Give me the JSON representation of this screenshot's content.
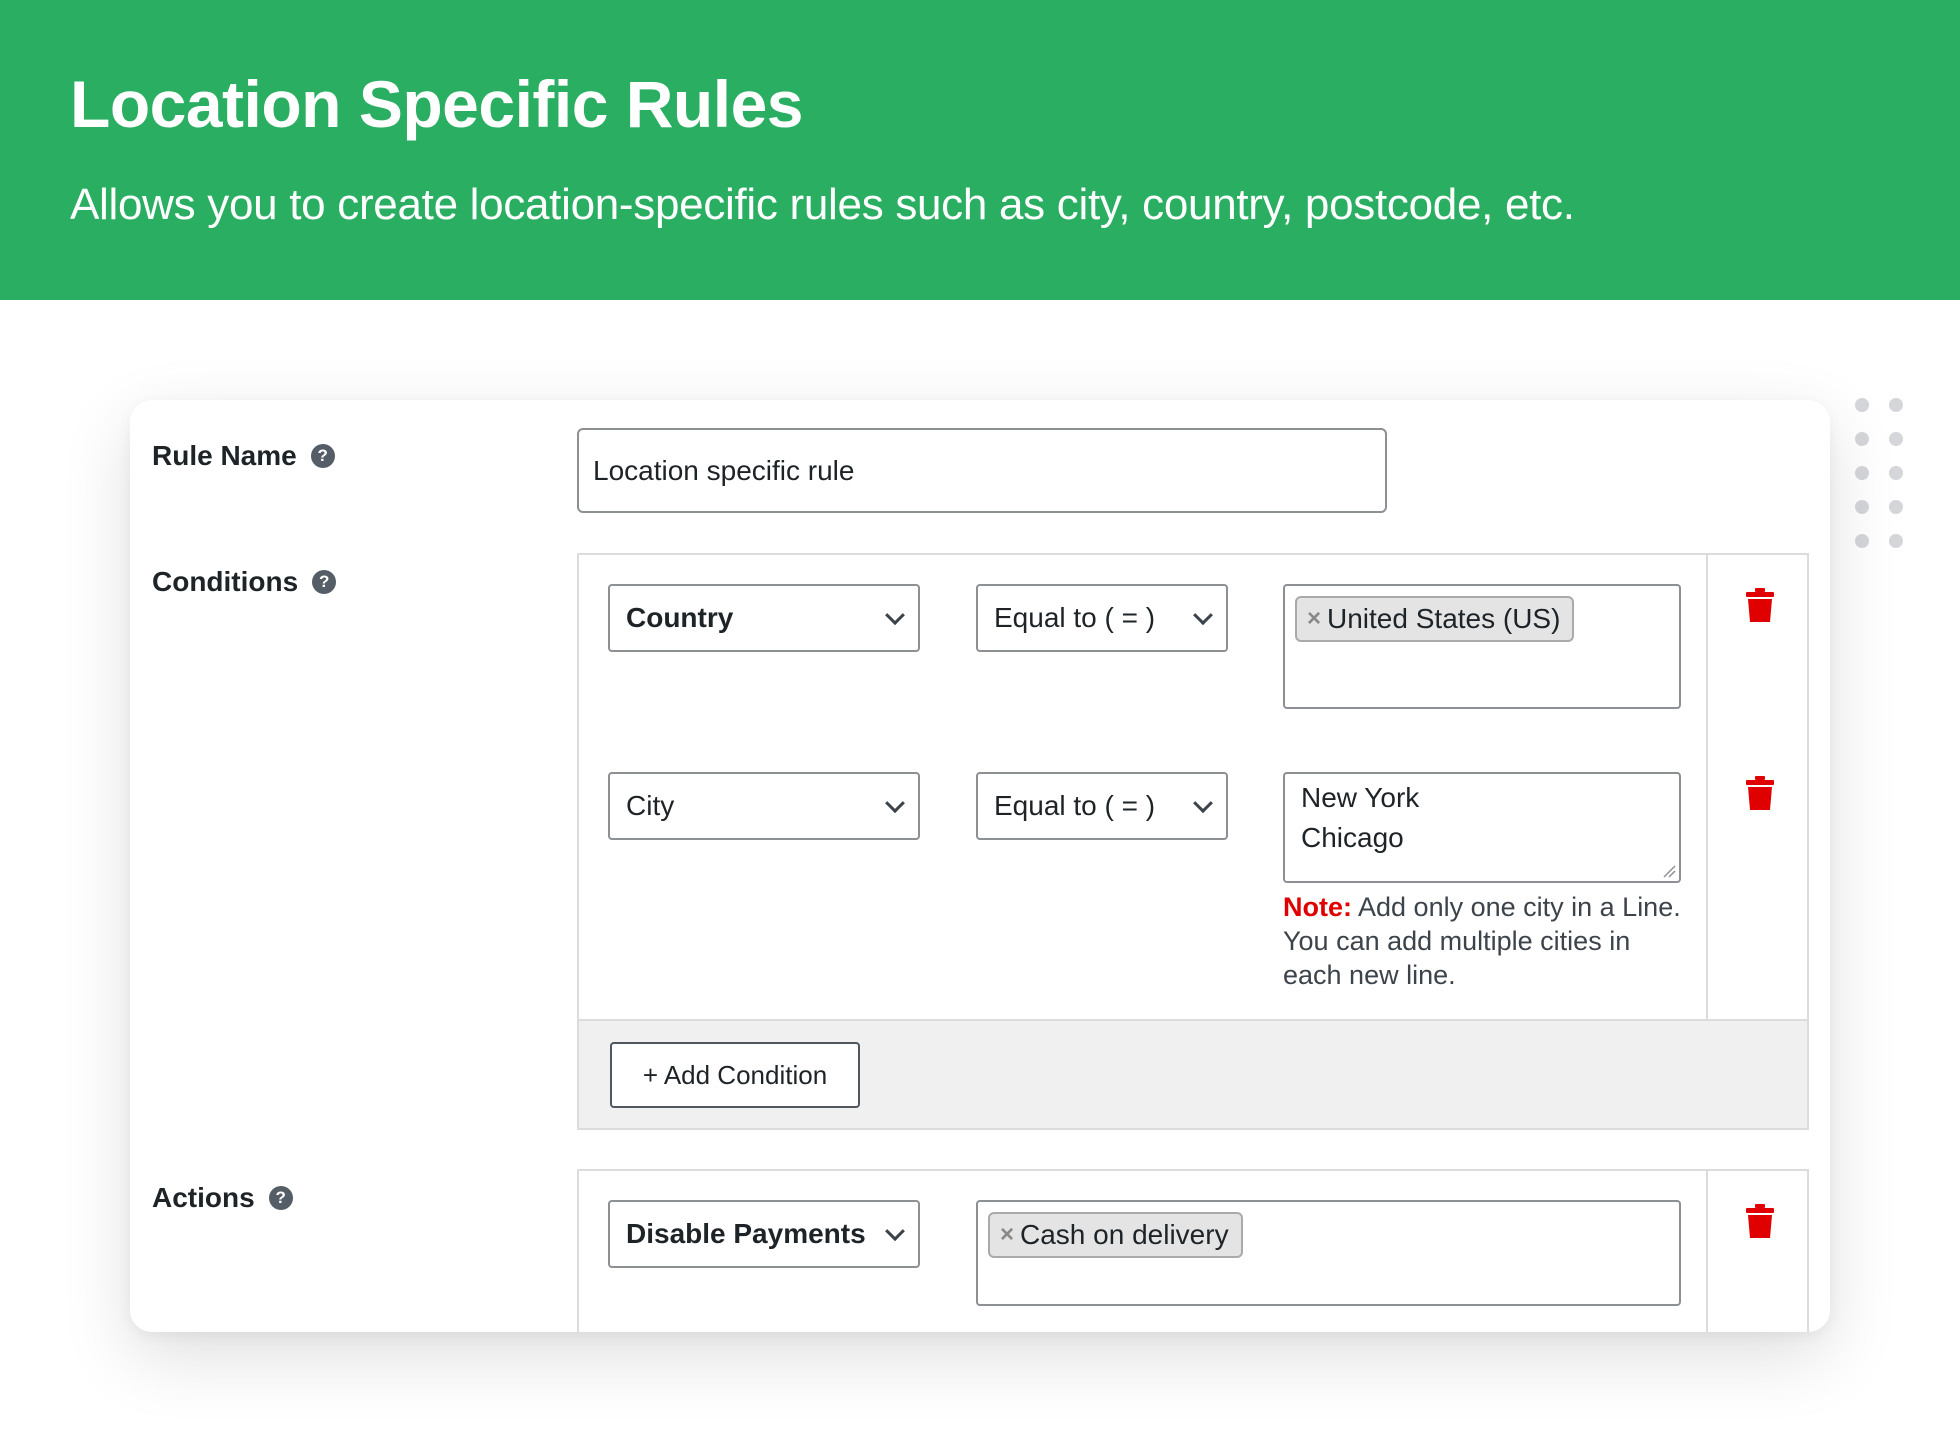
{
  "banner": {
    "title": "Location Specific Rules",
    "subtitle": "Allows you to create location-specific rules such as city, country, postcode, etc."
  },
  "colors": {
    "banner": "#2aae62",
    "danger": "#e00000"
  },
  "rule_name": {
    "label": "Rule Name",
    "help_icon": "question-circle-icon",
    "value": "Location specific rule"
  },
  "conditions": {
    "label": "Conditions",
    "help_icon": "question-circle-icon",
    "rows": [
      {
        "field": "Country",
        "operator": "Equal to ( = )",
        "tags": [
          "United States (US)"
        ]
      },
      {
        "field": "City",
        "operator": "Equal to ( = )",
        "lines": [
          "New York",
          "Chicago"
        ],
        "note_label": "Note:",
        "note_text": " Add only one city in a Line. You can add multiple cities in each new line."
      }
    ],
    "add_label": "+ Add Condition",
    "delete_icon": "trash-icon"
  },
  "actions": {
    "label": "Actions",
    "help_icon": "question-circle-icon",
    "rows": [
      {
        "type": "Disable Payments",
        "tags": [
          "Cash on delivery"
        ]
      }
    ]
  }
}
